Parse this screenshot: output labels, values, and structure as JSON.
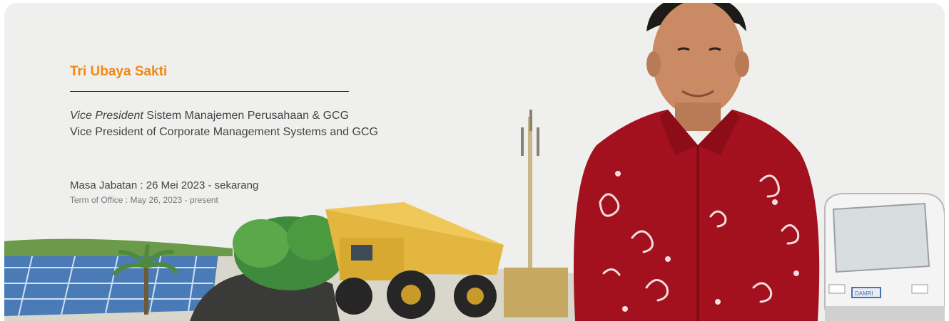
{
  "colors": {
    "accent": "#ee8a13",
    "background": "#efefee",
    "shirt": "#a3101e"
  },
  "profile": {
    "name": "Tri Ubaya Sakti",
    "position_prefix_id": "Vice President",
    "position_id": "Sistem Manajemen Perusahaan & GCG",
    "position_en": "Vice President of Corporate Management Systems and GCG",
    "term_id": "Masa Jabatan : 26 Mei 2023 - sekarang",
    "term_en": "Term of Office : May 26, 2023 - present"
  },
  "illustration": {
    "elements": [
      "solar-panels",
      "palm-tree",
      "rock-mound",
      "green-bush",
      "mining-dump-truck",
      "telecom-tower",
      "person-portrait-batik-shirt",
      "bus"
    ],
    "bus_label": "DAMRI"
  }
}
